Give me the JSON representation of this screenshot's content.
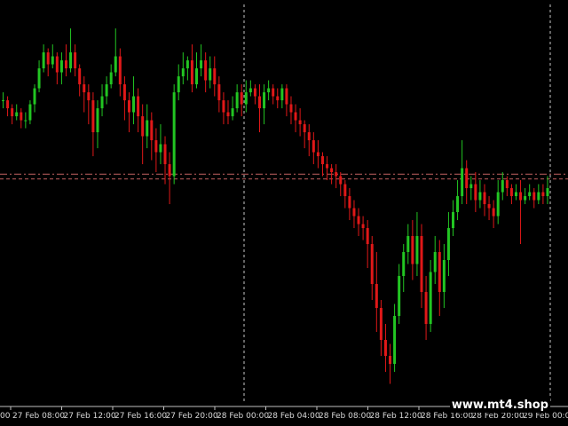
{
  "chart_data": {
    "type": "candlestick",
    "x_labels": [
      "27 Feb 08:00",
      "27 Feb 12:00",
      "27 Feb 16:00",
      "27 Feb 20:00",
      "28 Feb 00:00",
      "28 Feb 04:00",
      "28 Feb 08:00",
      "28 Feb 12:00",
      "28 Feb 16:00",
      "28 Feb 20:00",
      "29 Feb 00:00"
    ],
    "leading_label_fragment": "00",
    "colors": {
      "background": "#000000",
      "bull_candle": "#22c522",
      "bear_candle": "#e01818",
      "day_separator": "#c8c8c8",
      "price_line": "#c06060",
      "axis": "#c0c0c0",
      "label": "#d8d8d8"
    },
    "y_range": [
      0,
      100
    ],
    "price_level": 57.5,
    "price_level_2": 56.3,
    "day_separator_labels": [
      "28 Feb 00:00",
      "29 Feb 00:00"
    ],
    "candles": [
      [
        76,
        76,
        78,
        74
      ],
      [
        76,
        74,
        77,
        72
      ],
      [
        74,
        72,
        75,
        70
      ],
      [
        72,
        73,
        75,
        71
      ],
      [
        73,
        71,
        74,
        69
      ],
      [
        71,
        71,
        73,
        69
      ],
      [
        71,
        75,
        76,
        70
      ],
      [
        75,
        79,
        80,
        73
      ],
      [
        79,
        84,
        86,
        78
      ],
      [
        84,
        88,
        90,
        83
      ],
      [
        88,
        85,
        89,
        82
      ],
      [
        85,
        87,
        90,
        84
      ],
      [
        87,
        83,
        88,
        80
      ],
      [
        83,
        86,
        88,
        80
      ],
      [
        86,
        84,
        90,
        82
      ],
      [
        84,
        88,
        94,
        83
      ],
      [
        88,
        84,
        90,
        82
      ],
      [
        84,
        80,
        85,
        77
      ],
      [
        80,
        78,
        82,
        73
      ],
      [
        78,
        76,
        80,
        70
      ],
      [
        76,
        68,
        78,
        62
      ],
      [
        68,
        74,
        76,
        64
      ],
      [
        74,
        77,
        80,
        72
      ],
      [
        77,
        80,
        82,
        75
      ],
      [
        80,
        83,
        85,
        79
      ],
      [
        83,
        87,
        94,
        82
      ],
      [
        87,
        80,
        89,
        77
      ],
      [
        80,
        76,
        82,
        71
      ],
      [
        76,
        73,
        78,
        68
      ],
      [
        73,
        77,
        82,
        70
      ],
      [
        77,
        72,
        79,
        68
      ],
      [
        72,
        67,
        75,
        60
      ],
      [
        67,
        71,
        75,
        64
      ],
      [
        71,
        66,
        73,
        61
      ],
      [
        66,
        63,
        69,
        58
      ],
      [
        63,
        65,
        70,
        60
      ],
      [
        65,
        60,
        67,
        55
      ],
      [
        60,
        57,
        63,
        50
      ],
      [
        57,
        78,
        80,
        55
      ],
      [
        78,
        82,
        85,
        76
      ],
      [
        82,
        84,
        88,
        80
      ],
      [
        84,
        86,
        87,
        81
      ],
      [
        86,
        80,
        90,
        78
      ],
      [
        80,
        84,
        88,
        79
      ],
      [
        84,
        86,
        90,
        82
      ],
      [
        86,
        81,
        88,
        78
      ],
      [
        81,
        84,
        87,
        79
      ],
      [
        84,
        80,
        87,
        77
      ],
      [
        80,
        76,
        82,
        73
      ],
      [
        76,
        73,
        78,
        70
      ],
      [
        73,
        72,
        76,
        70
      ],
      [
        72,
        74,
        77,
        71
      ],
      [
        74,
        78,
        80,
        73
      ],
      [
        78,
        75,
        80,
        72
      ],
      [
        75,
        78,
        81,
        73
      ],
      [
        78,
        79,
        81,
        77
      ],
      [
        79,
        77,
        80,
        75
      ],
      [
        77,
        74,
        80,
        68
      ],
      [
        74,
        78,
        80,
        70
      ],
      [
        78,
        79,
        81,
        76
      ],
      [
        79,
        77,
        80,
        75
      ],
      [
        77,
        76,
        79,
        74
      ],
      [
        76,
        79,
        80,
        74
      ],
      [
        79,
        75,
        80,
        72
      ],
      [
        75,
        73,
        77,
        70
      ],
      [
        73,
        71,
        75,
        68
      ],
      [
        71,
        70,
        74,
        67
      ],
      [
        70,
        68,
        71,
        64
      ],
      [
        68,
        66,
        70,
        62
      ],
      [
        66,
        63,
        68,
        60
      ],
      [
        63,
        62,
        66,
        59
      ],
      [
        62,
        60,
        63,
        57
      ],
      [
        60,
        59,
        62,
        56
      ],
      [
        59,
        58,
        60,
        55
      ],
      [
        58,
        57,
        60,
        54
      ],
      [
        57,
        55,
        58,
        52
      ],
      [
        55,
        52,
        56,
        49
      ],
      [
        52,
        49,
        54,
        46
      ],
      [
        49,
        47,
        51,
        44
      ],
      [
        47,
        45,
        49,
        42
      ],
      [
        45,
        44,
        47,
        41
      ],
      [
        44,
        40,
        46,
        34
      ],
      [
        40,
        30,
        42,
        26
      ],
      [
        30,
        24,
        38,
        18
      ],
      [
        24,
        16,
        26,
        12
      ],
      [
        16,
        12,
        20,
        8
      ],
      [
        12,
        10,
        15,
        5
      ],
      [
        10,
        22,
        25,
        8
      ],
      [
        22,
        32,
        35,
        20
      ],
      [
        32,
        38,
        40,
        28
      ],
      [
        38,
        42,
        45,
        35
      ],
      [
        42,
        35,
        46,
        31
      ],
      [
        35,
        42,
        48,
        32
      ],
      [
        42,
        28,
        45,
        24
      ],
      [
        28,
        20,
        32,
        16
      ],
      [
        20,
        33,
        36,
        18
      ],
      [
        33,
        38,
        42,
        30
      ],
      [
        38,
        28,
        41,
        22
      ],
      [
        28,
        36,
        40,
        24
      ],
      [
        36,
        44,
        48,
        32
      ],
      [
        44,
        48,
        51,
        42
      ],
      [
        48,
        52,
        56,
        46
      ],
      [
        52,
        59,
        66,
        50
      ],
      [
        59,
        54,
        61,
        50
      ],
      [
        54,
        55,
        57,
        51
      ],
      [
        55,
        51,
        58,
        48
      ],
      [
        51,
        53,
        56,
        49
      ],
      [
        53,
        50,
        55,
        47
      ],
      [
        50,
        49,
        52,
        46
      ],
      [
        49,
        47,
        51,
        44
      ],
      [
        47,
        53,
        56,
        45
      ],
      [
        53,
        56,
        58,
        51
      ],
      [
        56,
        54,
        57,
        52
      ],
      [
        54,
        52,
        55,
        50
      ],
      [
        52,
        53,
        55,
        51
      ],
      [
        53,
        51,
        56,
        40
      ],
      [
        51,
        52,
        54,
        50
      ],
      [
        52,
        53,
        55,
        51
      ],
      [
        53,
        51,
        54,
        49
      ],
      [
        51,
        53,
        55,
        50
      ],
      [
        53,
        52,
        55,
        50
      ],
      [
        52,
        54,
        57,
        50
      ]
    ]
  },
  "watermark": "www.mt4.shop"
}
